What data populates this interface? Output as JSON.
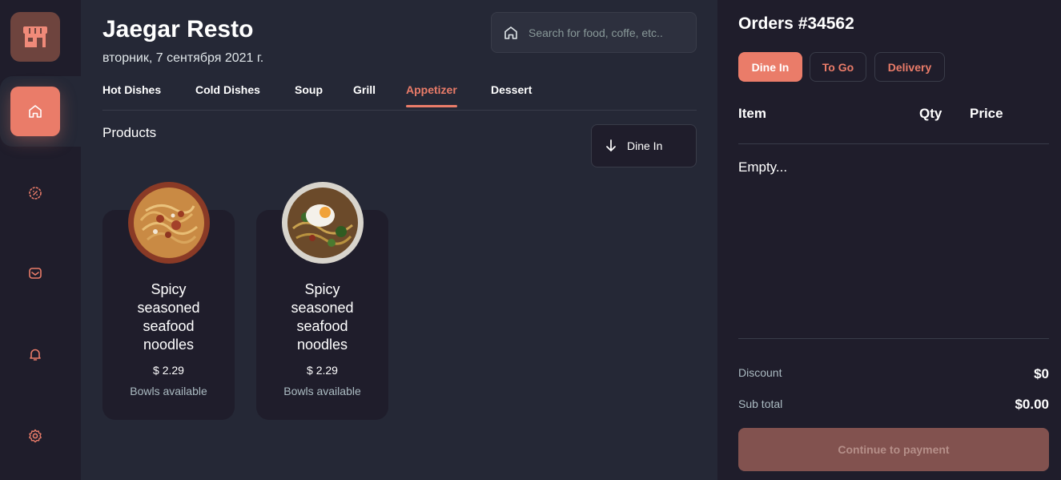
{
  "colors": {
    "accent": "#ea7c69",
    "background": "#252836",
    "panel": "#1f1d2b",
    "border": "#393c49"
  },
  "sidebar": {
    "logo": "store-icon",
    "items": [
      {
        "icon": "home-icon",
        "active": true
      },
      {
        "icon": "discount-icon",
        "active": false
      },
      {
        "icon": "dashboard-icon",
        "active": false
      },
      {
        "icon": "bell-icon",
        "active": false
      },
      {
        "icon": "gear-icon",
        "active": false
      }
    ]
  },
  "header": {
    "title": "Jaegar Resto",
    "date": "вторник, 7 сентября 2021 г.",
    "search": {
      "placeholder": "Search for food, coffe, etc..",
      "value": ""
    }
  },
  "tabs": [
    {
      "label": "Hot Dishes",
      "active": false
    },
    {
      "label": "Cold Dishes",
      "active": false
    },
    {
      "label": "Soup",
      "active": false
    },
    {
      "label": "Grill",
      "active": false
    },
    {
      "label": "Appetizer",
      "active": true
    },
    {
      "label": "Dessert",
      "active": false
    }
  ],
  "products": {
    "heading": "Products",
    "sort_button": "Dine In",
    "items": [
      {
        "name": "Spicy seasoned seafood noodles",
        "price": "$ 2.29",
        "availability": "Bowls available"
      },
      {
        "name": "Spicy seasoned seafood noodles",
        "price": "$ 2.29",
        "availability": "Bowls available"
      }
    ]
  },
  "order": {
    "title": "Orders #34562",
    "types": [
      {
        "label": "Dine In",
        "active": true
      },
      {
        "label": "To Go",
        "active": false
      },
      {
        "label": "Delivery",
        "active": false
      }
    ],
    "columns": {
      "item": "Item",
      "qty": "Qty",
      "price": "Price"
    },
    "empty_text": "Empty...",
    "discount_label": "Discount",
    "discount_value": "$0",
    "subtotal_label": "Sub total",
    "subtotal_value": "$0.00",
    "pay_button": "Continue to payment"
  }
}
